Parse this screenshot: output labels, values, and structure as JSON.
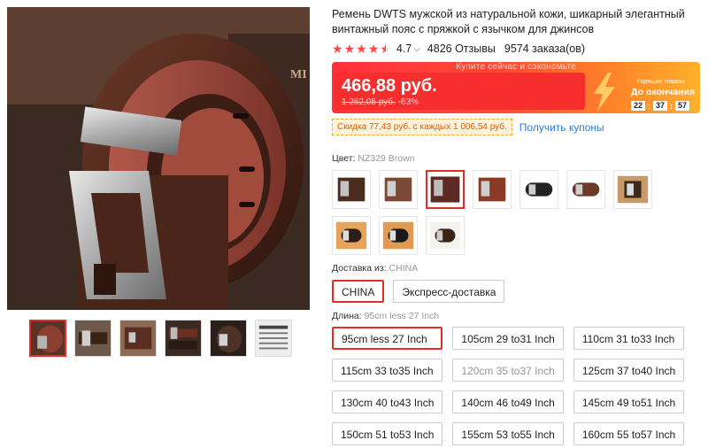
{
  "product": {
    "title": "Ремень DWTS мужской из натуральной кожи, шикарный элегантный винтажный пояс с пряжкой с язычком для джинсов",
    "rating": "4.7",
    "stars_filled": 4.5,
    "reviews": "4826 Отзывы",
    "orders": "9574 заказа(ов)"
  },
  "promo": {
    "banner": "Купите сейчас и сэкономьте",
    "price": "466,88 руб.",
    "old_price": "1 262,05 руб.",
    "discount": "-63%",
    "hot_label": "Горящие товары",
    "until_label": "До окончания",
    "timer": {
      "h": "22",
      "m": "37",
      "s": "57"
    },
    "colors": {
      "red": "#f62e2e",
      "orange": "#ffb12a"
    }
  },
  "coupon": {
    "text": "Скидка 77,43 руб. с каждых 1 006,54 руб.",
    "link": "Получить купоны"
  },
  "color": {
    "label": "Цвет:",
    "value": "NZ329 Brown",
    "swatch_count": 10,
    "selected_index": 2
  },
  "shipping": {
    "label": "Доставка из:",
    "value": "CHINA",
    "options": [
      "CHINA",
      "Экспресс-доставка"
    ]
  },
  "length": {
    "label": "Длина:",
    "value": "95cm less 27 Inch",
    "options": [
      "95cm less 27 Inch",
      "105cm 29 to31 Inch",
      "110cm 31 to33 Inch",
      "115cm 33 to35 Inch",
      "120cm 35 to37 Inch",
      "125cm 37 to40 Inch",
      "130cm 40 to43 Inch",
      "140cm 46 to49 Inch",
      "145cm 49 to51 Inch",
      "150cm 51 to53 Inch",
      "155cm 53 to55 Inch",
      "160cm 55 to57 Inch"
    ]
  }
}
